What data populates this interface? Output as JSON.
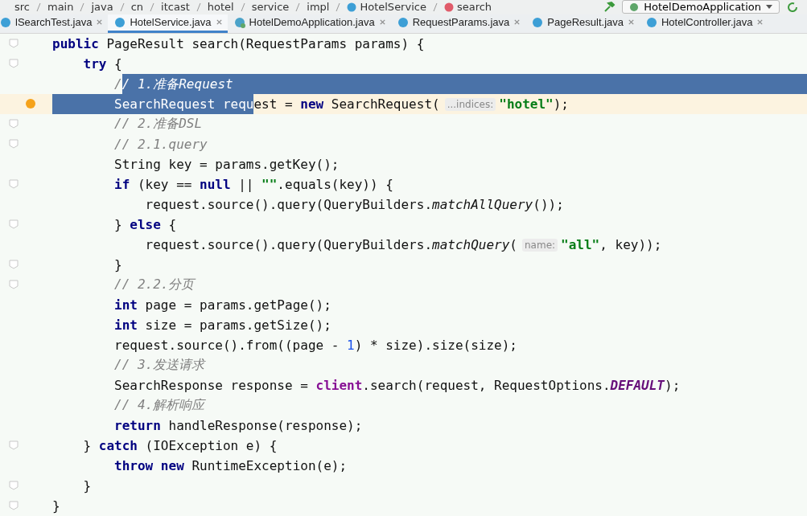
{
  "breadcrumb": [
    {
      "text": "src",
      "kind": "folder"
    },
    {
      "text": "main",
      "kind": "folder"
    },
    {
      "text": "java",
      "kind": "folder"
    },
    {
      "text": "cn",
      "kind": "folder"
    },
    {
      "text": "itcast",
      "kind": "folder"
    },
    {
      "text": "hotel",
      "kind": "folder"
    },
    {
      "text": "service",
      "kind": "folder"
    },
    {
      "text": "impl",
      "kind": "folder"
    },
    {
      "text": "HotelService",
      "kind": "class"
    },
    {
      "text": "search",
      "kind": "method"
    }
  ],
  "run_config": "HotelDemoApplication",
  "tabs": [
    {
      "label": "lSearchTest.java",
      "selected": false,
      "kind": "class"
    },
    {
      "label": "HotelService.java",
      "selected": true,
      "kind": "class"
    },
    {
      "label": "HotelDemoApplication.java",
      "selected": false,
      "kind": "app"
    },
    {
      "label": "RequestParams.java",
      "selected": false,
      "kind": "class"
    },
    {
      "label": "PageResult.java",
      "selected": false,
      "kind": "class"
    },
    {
      "label": "HotelController.java",
      "selected": false,
      "kind": "class"
    }
  ],
  "lines": [
    {
      "fold": true,
      "breakpoint": false,
      "current": false,
      "tokens": [
        {
          "text": "public",
          "kind": "kw",
          "selected": false
        },
        {
          "text": " PageResult search(RequestParams params) {",
          "kind": "plain",
          "selected": false
        }
      ]
    },
    {
      "fold": true,
      "breakpoint": false,
      "current": false,
      "tokens": [
        {
          "text": "    try",
          "kind": "kw",
          "selected": false
        },
        {
          "text": " {",
          "kind": "plain",
          "selected": false
        }
      ]
    },
    {
      "fold": false,
      "breakpoint": false,
      "current": false,
      "tokens": [
        {
          "text": "        /",
          "kind": "comment",
          "selected": false
        },
        {
          "text": "/ 1.准备Request",
          "kind": "comment",
          "selected": true
        }
      ]
    },
    {
      "fold": false,
      "breakpoint": true,
      "current": true,
      "tokens": [
        {
          "text": "        SearchRequest requ",
          "kind": "plain",
          "selected": true
        },
        {
          "text": "est = ",
          "kind": "plain",
          "selected": false
        },
        {
          "text": "new",
          "kind": "kw",
          "selected": false
        },
        {
          "text": " SearchRequest(",
          "kind": "plain",
          "selected": false
        },
        {
          "text": "...indices:",
          "kind": "hint",
          "selected": false
        },
        {
          "text": "\"hotel\"",
          "kind": "string",
          "selected": false
        },
        {
          "text": ");",
          "kind": "plain",
          "selected": false
        }
      ]
    },
    {
      "fold": true,
      "breakpoint": false,
      "current": false,
      "tokens": [
        {
          "text": "        // 2.准备DSL",
          "kind": "comment",
          "selected": false
        }
      ]
    },
    {
      "fold": true,
      "breakpoint": false,
      "current": false,
      "tokens": [
        {
          "text": "        // 2.1.query",
          "kind": "comment",
          "selected": false
        }
      ]
    },
    {
      "fold": false,
      "breakpoint": false,
      "current": false,
      "tokens": [
        {
          "text": "        String key = params.getKey();",
          "kind": "plain",
          "selected": false
        }
      ]
    },
    {
      "fold": true,
      "breakpoint": false,
      "current": false,
      "tokens": [
        {
          "text": "        if",
          "kind": "kw",
          "selected": false
        },
        {
          "text": " (key == ",
          "kind": "plain",
          "selected": false
        },
        {
          "text": "null",
          "kind": "kw",
          "selected": false
        },
        {
          "text": " || ",
          "kind": "plain",
          "selected": false
        },
        {
          "text": "\"\"",
          "kind": "string",
          "selected": false
        },
        {
          "text": ".equals(key)) {",
          "kind": "plain",
          "selected": false
        }
      ]
    },
    {
      "fold": false,
      "breakpoint": false,
      "current": false,
      "tokens": [
        {
          "text": "            request.source().query(QueryBuilders.",
          "kind": "plain",
          "selected": false
        },
        {
          "text": "matchAllQuery",
          "kind": "static",
          "selected": false
        },
        {
          "text": "());",
          "kind": "plain",
          "selected": false
        }
      ]
    },
    {
      "fold": true,
      "breakpoint": false,
      "current": false,
      "tokens": [
        {
          "text": "        } ",
          "kind": "plain",
          "selected": false
        },
        {
          "text": "else",
          "kind": "kw",
          "selected": false
        },
        {
          "text": " {",
          "kind": "plain",
          "selected": false
        }
      ]
    },
    {
      "fold": false,
      "breakpoint": false,
      "current": false,
      "tokens": [
        {
          "text": "            request.source().query(QueryBuilders.",
          "kind": "plain",
          "selected": false
        },
        {
          "text": "matchQuery",
          "kind": "static",
          "selected": false
        },
        {
          "text": "(",
          "kind": "plain",
          "selected": false
        },
        {
          "text": "name:",
          "kind": "hint",
          "selected": false
        },
        {
          "text": "\"all\"",
          "kind": "string",
          "selected": false
        },
        {
          "text": ", key));",
          "kind": "plain",
          "selected": false
        }
      ]
    },
    {
      "fold": true,
      "breakpoint": false,
      "current": false,
      "tokens": [
        {
          "text": "        }",
          "kind": "plain",
          "selected": false
        }
      ]
    },
    {
      "fold": true,
      "breakpoint": false,
      "current": false,
      "tokens": [
        {
          "text": "        // 2.2.分页",
          "kind": "comment",
          "selected": false
        }
      ]
    },
    {
      "fold": false,
      "breakpoint": false,
      "current": false,
      "tokens": [
        {
          "text": "        int",
          "kind": "kw",
          "selected": false
        },
        {
          "text": " page = params.getPage();",
          "kind": "plain",
          "selected": false
        }
      ]
    },
    {
      "fold": false,
      "breakpoint": false,
      "current": false,
      "tokens": [
        {
          "text": "        int",
          "kind": "kw",
          "selected": false
        },
        {
          "text": " size = params.getSize();",
          "kind": "plain",
          "selected": false
        }
      ]
    },
    {
      "fold": false,
      "breakpoint": false,
      "current": false,
      "tokens": [
        {
          "text": "        request.source().from((page - ",
          "kind": "plain",
          "selected": false
        },
        {
          "text": "1",
          "kind": "number",
          "selected": false
        },
        {
          "text": ") * size).size(size);",
          "kind": "plain",
          "selected": false
        }
      ]
    },
    {
      "fold": false,
      "breakpoint": false,
      "current": false,
      "tokens": [
        {
          "text": "        // 3.发送请求",
          "kind": "comment",
          "selected": false
        }
      ]
    },
    {
      "fold": false,
      "breakpoint": false,
      "current": false,
      "tokens": [
        {
          "text": "        SearchResponse response = ",
          "kind": "plain",
          "selected": false
        },
        {
          "text": "client",
          "kind": "field",
          "selected": false
        },
        {
          "text": ".search(request, RequestOptions.",
          "kind": "plain",
          "selected": false
        },
        {
          "text": "DEFAULT",
          "kind": "constant",
          "selected": false
        },
        {
          "text": ");",
          "kind": "plain",
          "selected": false
        }
      ]
    },
    {
      "fold": false,
      "breakpoint": false,
      "current": false,
      "tokens": [
        {
          "text": "        // 4.解析响应",
          "kind": "comment",
          "selected": false
        }
      ]
    },
    {
      "fold": false,
      "breakpoint": false,
      "current": false,
      "tokens": [
        {
          "text": "        return",
          "kind": "kw",
          "selected": false
        },
        {
          "text": " handleResponse(response);",
          "kind": "plain",
          "selected": false
        }
      ]
    },
    {
      "fold": true,
      "breakpoint": false,
      "current": false,
      "tokens": [
        {
          "text": "    } ",
          "kind": "plain",
          "selected": false
        },
        {
          "text": "catch",
          "kind": "kw",
          "selected": false
        },
        {
          "text": " (IOException e) {",
          "kind": "plain",
          "selected": false
        }
      ]
    },
    {
      "fold": false,
      "breakpoint": false,
      "current": false,
      "tokens": [
        {
          "text": "        throw new",
          "kind": "kw",
          "selected": false
        },
        {
          "text": " RuntimeException(e);",
          "kind": "plain",
          "selected": false
        }
      ]
    },
    {
      "fold": true,
      "breakpoint": false,
      "current": false,
      "tokens": [
        {
          "text": "    }",
          "kind": "plain",
          "selected": false
        }
      ]
    },
    {
      "fold": true,
      "breakpoint": false,
      "current": false,
      "tokens": [
        {
          "text": "}",
          "kind": "plain",
          "selected": false
        }
      ]
    }
  ]
}
